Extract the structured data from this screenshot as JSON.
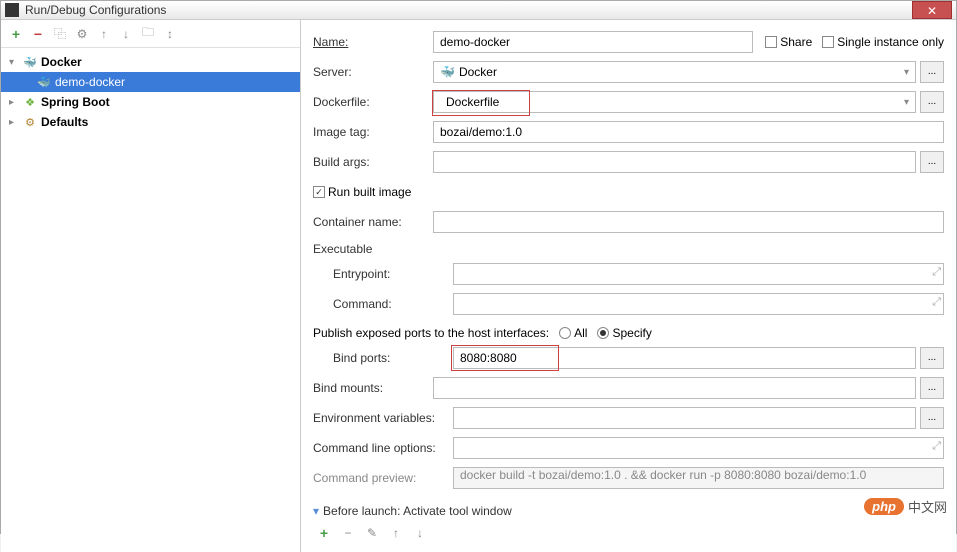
{
  "window": {
    "title": "Run/Debug Configurations"
  },
  "toolbar": {
    "add": "+",
    "remove": "−",
    "copy": "⿻",
    "wrench": "⚙",
    "up": "↑",
    "down": "↓",
    "folder": "🗀",
    "expand": "↕"
  },
  "tree": {
    "items": [
      {
        "label": "Docker",
        "icon": "🐳",
        "toggle": "▾",
        "bold": true
      },
      {
        "label": "demo-docker",
        "icon": "🐳",
        "selected": true
      },
      {
        "label": "Spring Boot",
        "icon": "❖",
        "toggle": "▸",
        "bold": true
      },
      {
        "label": "Defaults",
        "icon": "⚙",
        "toggle": "▸",
        "bold": true
      }
    ]
  },
  "form": {
    "name_label": "Name:",
    "name_value": "demo-docker",
    "share_label": "Share",
    "single_label": "Single instance only",
    "server_label": "Server:",
    "server_value": "Docker",
    "dockerfile_label": "Dockerfile:",
    "dockerfile_value": "Dockerfile",
    "imagetag_label": "Image tag:",
    "imagetag_value": "bozai/demo:1.0",
    "buildargs_label": "Build args:",
    "buildargs_value": "",
    "runbuilt_label": "Run built image",
    "container_label": "Container name:",
    "container_value": "",
    "executable_label": "Executable",
    "entrypoint_label": "Entrypoint:",
    "entrypoint_value": "",
    "command_label": "Command:",
    "command_value": "",
    "publish_label": "Publish exposed ports to the host interfaces:",
    "all_label": "All",
    "specify_label": "Specify",
    "bindports_label": "Bind ports:",
    "bindports_value": "8080:8080",
    "bindmounts_label": "Bind mounts:",
    "bindmounts_value": "",
    "envvars_label": "Environment variables:",
    "envvars_value": "",
    "cmdopts_label": "Command line options:",
    "cmdopts_value": "",
    "cmdpreview_label": "Command preview:",
    "cmdpreview_value": "docker build -t bozai/demo:1.0 . && docker run -p 8080:8080 bozai/demo:1.0",
    "beforelaunch_label": "Before launch: Activate tool window",
    "more": "..."
  },
  "bl_toolbar": {
    "add": "+",
    "remove": "−",
    "edit": "✎",
    "up": "↑",
    "down": "↓"
  },
  "watermark": {
    "badge": "php",
    "text": "中文网"
  }
}
